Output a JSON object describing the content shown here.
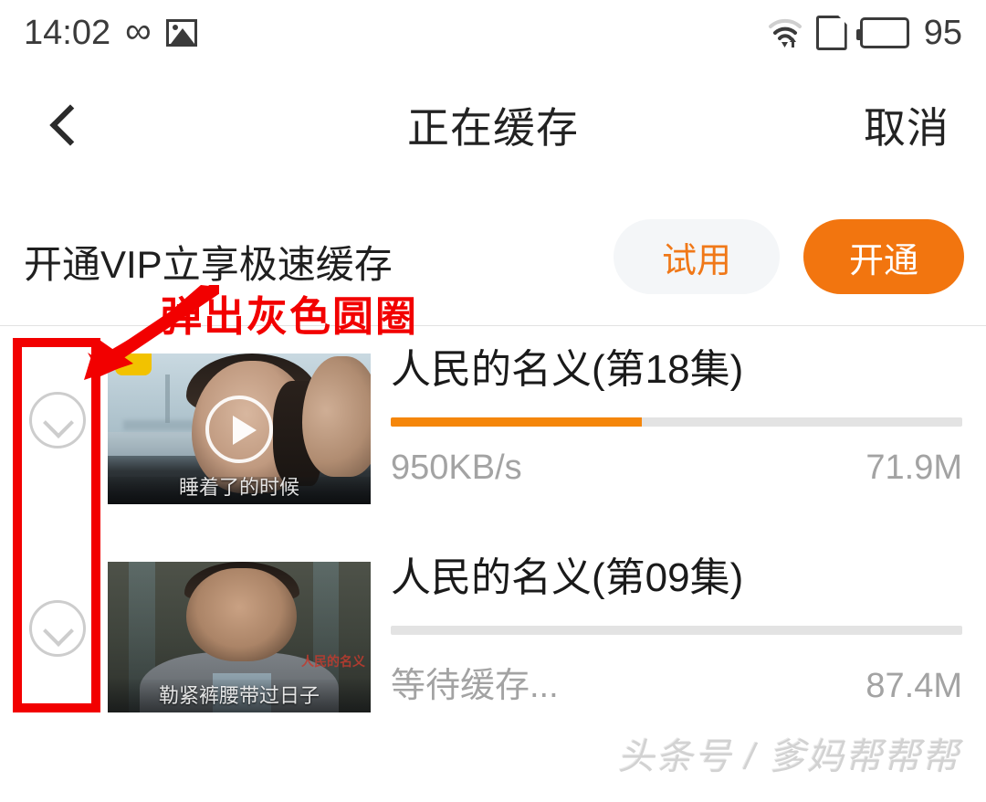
{
  "status_bar": {
    "time": "14:02",
    "infinity_glyph": "∞",
    "photo_icon_name": "photo-icon",
    "wifi_icon_name": "wifi-icon",
    "sim_icon_name": "sim-card-icon",
    "battery_icon_name": "battery-icon",
    "battery_level": "95"
  },
  "nav": {
    "back_icon_name": "back-chevron-icon",
    "title": "正在缓存",
    "cancel_label": "取消"
  },
  "vip_banner": {
    "text": "开通VIP立享极速缓存",
    "trial_label": "试用",
    "open_label": "开通",
    "trial_bg": "#f4f6f8",
    "trial_fg": "#f07818",
    "open_bg": "#f2750f",
    "open_fg": "#ffffff"
  },
  "download_list": [
    {
      "checkbox_icon_name": "chevron-down-circle-icon",
      "title": "人民的名义(第18集)",
      "progress_percent": 44,
      "status": "950KB/s",
      "size": "71.9M",
      "thumb_subtitle": "睡着了的时候",
      "progress_fill_color": "#f5860a",
      "progress_track_color": "#e3e3e3"
    },
    {
      "checkbox_icon_name": "chevron-down-circle-icon",
      "title": "人民的名义(第09集)",
      "progress_percent": 0,
      "status": "等待缓存...",
      "size": "87.4M",
      "thumb_subtitle": "勒紧裤腰带过日子",
      "progress_fill_color": "#f5860a",
      "progress_track_color": "#e3e3e3"
    }
  ],
  "annotation": {
    "text": "弹出灰色圆圈",
    "color": "#f20000"
  },
  "watermark": {
    "text": "头条号 / 爹妈帮帮帮"
  }
}
